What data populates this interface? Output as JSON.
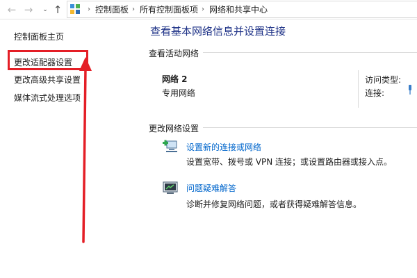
{
  "breadcrumb": {
    "items": [
      "控制面板",
      "所有控制面板项",
      "网络和共享中心"
    ]
  },
  "nav": {
    "back_glyph": "←",
    "forward_glyph": "→",
    "up_glyph": "↑"
  },
  "sidebar": {
    "items": [
      {
        "label": "控制面板主页"
      },
      {
        "label": "更改适配器设置"
      },
      {
        "label": "更改高级共享设置"
      },
      {
        "label": "媒体流式处理选项"
      }
    ]
  },
  "main": {
    "title": "查看基本网络信息并设置连接",
    "active_networks": {
      "label": "查看活动网络",
      "network_name": "网络  2",
      "network_type": "专用网络",
      "access_type_label": "访问类型:",
      "connection_label": "连接:"
    },
    "change_settings": {
      "label": "更改网络设置",
      "tasks": [
        {
          "link": "设置新的连接或网络",
          "desc": "设置宽带、拨号或 VPN 连接；或设置路由器或接入点。",
          "icon": "new-connection-icon"
        },
        {
          "link": "问题疑难解答",
          "desc": "诊断并修复网络问题，或者获得疑难解答信息。",
          "icon": "troubleshoot-icon"
        }
      ]
    }
  },
  "colors": {
    "title_blue": "#1e3287",
    "link_blue": "#0066cc",
    "annotation_red": "#e41e26"
  }
}
